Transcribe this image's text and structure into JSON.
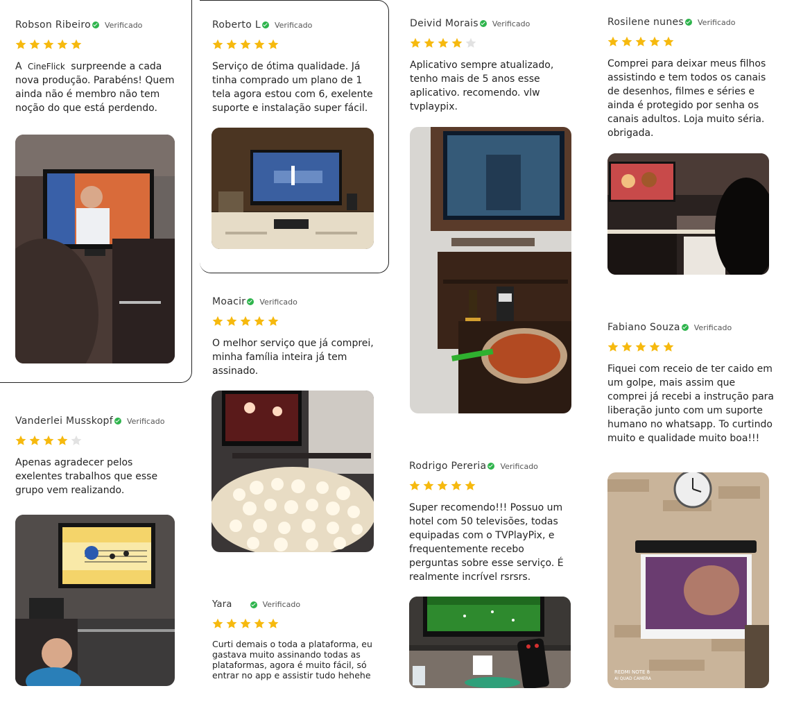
{
  "verified_label": "Verificado",
  "colors": {
    "star_filled": "#f6b90e",
    "star_empty": "#e2e2e2",
    "check": "#2eb44c"
  },
  "reviews": [
    {
      "name": "Robson Ribeiro",
      "rating": 5,
      "text_before": "A ",
      "brand": "CineFlick",
      "text_after": " surpreende a cada nova produção. Parabéns! Quem ainda não é membro não tem noção do que está perdendo.",
      "photo": "Man on TV screen in living room"
    },
    {
      "name": "Roberto L",
      "rating": 5,
      "text": "Serviço de ótima qualidade. Já tinha comprado um plano de 1 tela agora estou com 6, exelente suporte e instalação super fácil.",
      "photo": "Table tennis match on TV"
    },
    {
      "name": "Deivid Morais",
      "rating": 4,
      "text": "Aplicativo sempre atualizado, tenho mais de 5 anos esse aplicativo. recomendo. vlw tvplaypix.",
      "photo": "TV on wall with food and beer"
    },
    {
      "name": "Rosilene nunes",
      "rating": 5,
      "text": "Comprei para deixar meus filhos assistindo e tem todos os canais de desenhos, filmes e séries e ainda é protegido por senha os canais adultos. Loja muito séria. obrigada.",
      "photo": "Cartoon on TV in living room"
    },
    {
      "name": "Moacir",
      "rating": 5,
      "text": "O melhor serviço que já comprei, minha família inteira já tem assinado.",
      "photo": "Popcorn bowl in front of TV"
    },
    {
      "name": "Fabiano Souza",
      "rating": 5,
      "text": "Fiquei com receio de ter caido em um golpe, mais assim que comprei já recebi a instrução para liberação junto com um suporte humano no whatsapp. To curtindo muito e qualidade muito boa!!!",
      "photo": "TV mounted on brick wall with clock",
      "photo_watermark_1": "REDMI NOTE 8",
      "photo_watermark_2": "AI QUAD CAMERA"
    },
    {
      "name": "Vanderlei Musskopf",
      "rating": 4,
      "text": "Apenas agradecer pelos exelentes trabalhos que esse grupo vem realizando.",
      "photo": "Child watching cartoon on TV"
    },
    {
      "name": "Rodrigo Pereria",
      "rating": 5,
      "text": "Super recomendo!!! Possuo um hotel com 50 televisões, todas equipadas com o TVPlayPix, e frequentemente recebo perguntas sobre esse serviço. É realmente incrível rsrsrs.",
      "photo": "Football match on TV with remote"
    },
    {
      "name": "Yara",
      "rating": 5,
      "text": "Curti demais o toda a plataforma, eu gastava muito assinando todas as plataformas, agora é muito fácil, só entrar no app e assistir tudo hehehe"
    }
  ]
}
